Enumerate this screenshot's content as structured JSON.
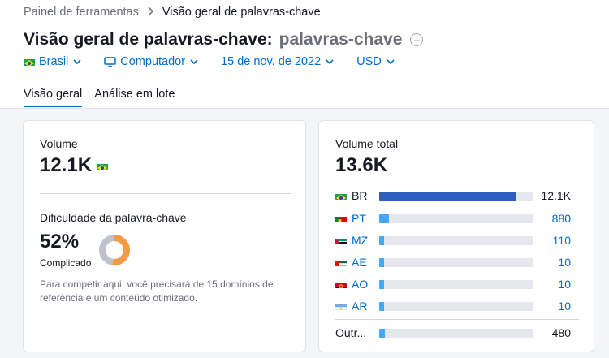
{
  "breadcrumb": {
    "root": "Painel de ferramentas",
    "current": "Visão geral de palavras-chave"
  },
  "title": {
    "text": "Visão geral de palavras-chave:",
    "keyword": "palavras-chave"
  },
  "filters": {
    "country": "Brasil",
    "device": "Computador",
    "date": "15 de nov. de 2022",
    "currency": "USD"
  },
  "tabs": [
    {
      "label": "Visão geral",
      "active": true
    },
    {
      "label": "Análise em lote",
      "active": false
    }
  ],
  "volume": {
    "label": "Volume",
    "value": "12.1K"
  },
  "difficulty": {
    "label": "Dificuldade da palavra-chave",
    "value": "52%",
    "percent": 52,
    "level": "Complicado",
    "description": "Para competir aqui, você precisará de 15 domínios de referência e um conteúdo otimizado."
  },
  "total_volume": {
    "label": "Volume total",
    "value": "13.6K",
    "rows": [
      {
        "code": "BR",
        "value": "12.1K",
        "fraction": 0.89,
        "link": false,
        "flag": "brazil-flag"
      },
      {
        "code": "PT",
        "value": "880",
        "fraction": 0.065,
        "link": true,
        "flag": "portugal-flag"
      },
      {
        "code": "MZ",
        "value": "110",
        "fraction": 0.01,
        "link": true,
        "flag": "mozambique-flag"
      },
      {
        "code": "AE",
        "value": "10",
        "fraction": 0.005,
        "link": true,
        "flag": "uae-flag"
      },
      {
        "code": "AO",
        "value": "10",
        "fraction": 0.005,
        "link": true,
        "flag": "angola-flag"
      },
      {
        "code": "AR",
        "value": "10",
        "fraction": 0.005,
        "link": true,
        "flag": "argentina-flag"
      },
      {
        "code": "Outr...",
        "value": "480",
        "fraction": 0.035,
        "link": false,
        "flag": ""
      }
    ]
  },
  "colors": {
    "accent": "#006dca",
    "bar_primary": "#2e5ec0",
    "bar_secondary": "#45a7f5",
    "kd_orange": "#f49a46",
    "kd_track": "#bfc2cc"
  }
}
